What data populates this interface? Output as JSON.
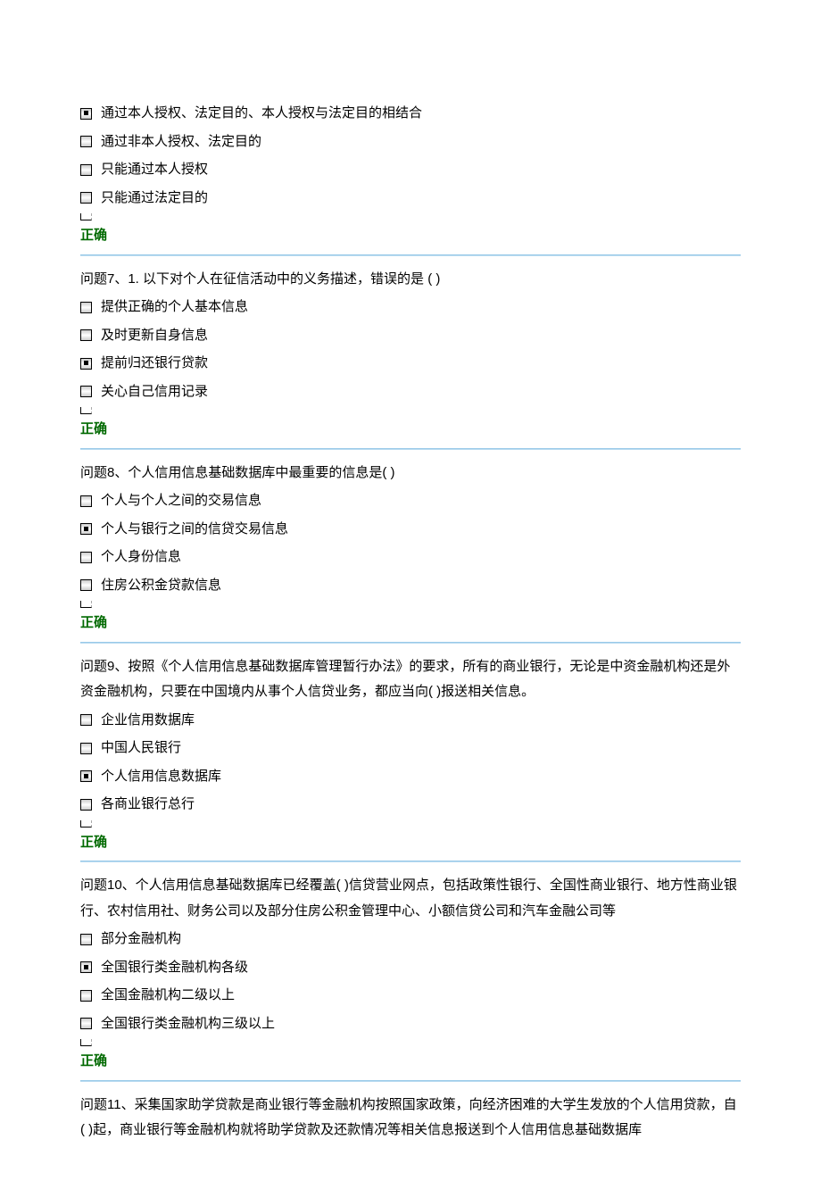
{
  "correct_label": "正确",
  "questions": [
    {
      "text": "",
      "options": [
        {
          "label": "通过本人授权、法定目的、本人授权与法定目的相结合",
          "selected": true
        },
        {
          "label": "通过非本人授权、法定目的",
          "selected": false
        },
        {
          "label": "只能通过本人授权",
          "selected": false
        },
        {
          "label": "只能通过法定目的",
          "selected": false
        }
      ]
    },
    {
      "text": "问题7、1. 以下对个人在征信活动中的义务描述，错误的是 ( )",
      "options": [
        {
          "label": "提供正确的个人基本信息",
          "selected": false
        },
        {
          "label": "及时更新自身信息",
          "selected": false
        },
        {
          "label": "提前归还银行贷款",
          "selected": true
        },
        {
          "label": "关心自己信用记录",
          "selected": false
        }
      ]
    },
    {
      "text": "问题8、个人信用信息基础数据库中最重要的信息是( )",
      "options": [
        {
          "label": "个人与个人之间的交易信息",
          "selected": false
        },
        {
          "label": "个人与银行之间的信贷交易信息",
          "selected": true
        },
        {
          "label": "个人身份信息",
          "selected": false
        },
        {
          "label": "住房公积金贷款信息",
          "selected": false
        }
      ]
    },
    {
      "text": "问题9、按照《个人信用信息基础数据库管理暂行办法》的要求，所有的商业银行，无论是中资金融机构还是外资金融机构，只要在中国境内从事个人信贷业务，都应当向( )报送相关信息。",
      "options": [
        {
          "label": "企业信用数据库",
          "selected": false
        },
        {
          "label": "中国人民银行",
          "selected": false
        },
        {
          "label": "个人信用信息数据库",
          "selected": true
        },
        {
          "label": "各商业银行总行",
          "selected": false
        }
      ]
    },
    {
      "text": "问题10、个人信用信息基础数据库已经覆盖( )信贷营业网点，包括政策性银行、全国性商业银行、地方性商业银行、农村信用社、财务公司以及部分住房公积金管理中心、小额信贷公司和汽车金融公司等",
      "options": [
        {
          "label": "部分金融机构",
          "selected": false
        },
        {
          "label": "全国银行类金融机构各级",
          "selected": true
        },
        {
          "label": "全国金融机构二级以上",
          "selected": false
        },
        {
          "label": "全国银行类金融机构三级以上",
          "selected": false
        }
      ]
    },
    {
      "text": "问题11、采集国家助学贷款是商业银行等金融机构按照国家政策，向经济困难的大学生发放的个人信用贷款，自( )起，商业银行等金融机构就将助学贷款及还款情况等相关信息报送到个人信用信息基础数据库",
      "options": []
    }
  ]
}
